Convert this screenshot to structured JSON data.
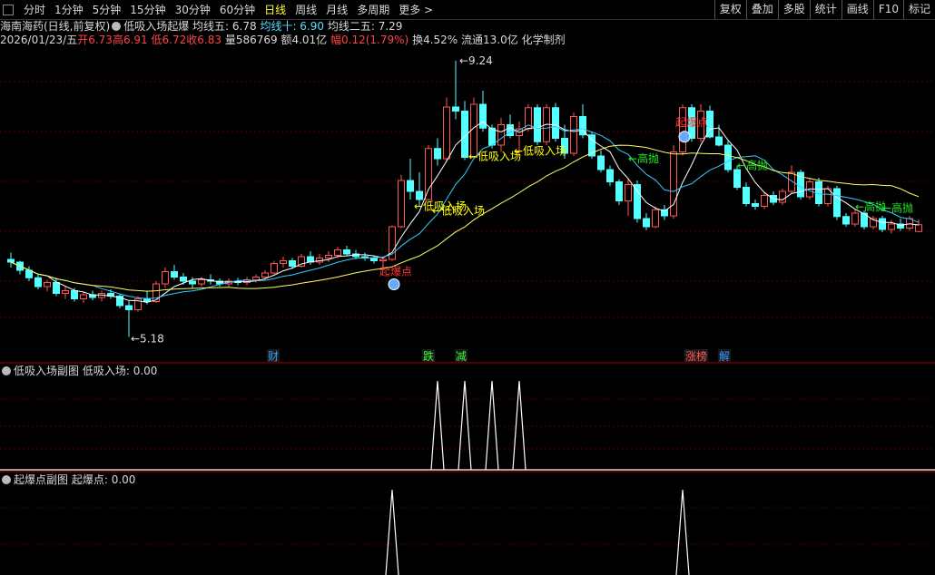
{
  "toolbar": {
    "tabs": [
      "分时",
      "1分钟",
      "5分钟",
      "15分钟",
      "30分钟",
      "60分钟",
      "日线",
      "周线",
      "月线",
      "多周期",
      "更多 >"
    ],
    "active_index": 6,
    "right_buttons": [
      "复权",
      "叠加",
      "多股",
      "统计",
      "画线",
      "F10",
      "标记"
    ]
  },
  "header": {
    "stock": "海南海药(日线,前复权)",
    "indicator": "低吸入场起爆",
    "ma5": "均线五: 6.78",
    "ma10": "均线十: 6.90",
    "ma25": "均线二五: 7.29"
  },
  "quote": {
    "date": "2026/01/23/五",
    "open": "开6.73",
    "high": "高6.91",
    "low": "低6.72",
    "close": "收6.83",
    "volume": "量586769",
    "amount": "额4.01亿",
    "change": "幅0.12(1.79%)",
    "turnover": "换4.52%",
    "float": "流通13.0亿",
    "sector": "化学制剂"
  },
  "chart_annotations": {
    "high_label": "9.24",
    "low_label": "5.18",
    "signals": [
      "低吸入场",
      "低吸入场",
      "低吸入场",
      "低吸入场"
    ],
    "burst": [
      "起爆点",
      "起爆点"
    ],
    "sell": [
      "高抛",
      "高抛",
      "高抛",
      "高抛"
    ],
    "event_tags": [
      "财",
      "跌",
      "减",
      "涨榜",
      "解"
    ]
  },
  "subchart1": {
    "label": "低吸入场副图",
    "value": "低吸入场: 0.00"
  },
  "subchart2": {
    "label": "起爆点副图",
    "value": "起爆点: 0.00"
  },
  "colors": {
    "up": "#ff5555",
    "down": "#55ffff",
    "ma5": "#ffffff",
    "ma10": "#33ccff",
    "ma25": "#ffff66",
    "signal": "#ffff00",
    "sell": "#22ee22",
    "grid": "#5a0000"
  },
  "chart_data": {
    "type": "candlestick",
    "price_range": [
      5.0,
      9.4
    ],
    "candles": [
      [
        6.32,
        6.42,
        6.2,
        6.28
      ],
      [
        6.28,
        6.3,
        6.1,
        6.16
      ],
      [
        6.16,
        6.22,
        6.0,
        6.05
      ],
      [
        6.05,
        6.1,
        5.88,
        5.92
      ],
      [
        5.92,
        6.02,
        5.85,
        5.98
      ],
      [
        5.98,
        6.05,
        5.78,
        5.82
      ],
      [
        5.82,
        5.92,
        5.74,
        5.86
      ],
      [
        5.86,
        5.9,
        5.7,
        5.74
      ],
      [
        5.74,
        5.84,
        5.68,
        5.8
      ],
      [
        5.8,
        5.86,
        5.72,
        5.76
      ],
      [
        5.76,
        5.86,
        5.7,
        5.82
      ],
      [
        5.82,
        5.88,
        5.74,
        5.78
      ],
      [
        5.78,
        5.82,
        5.6,
        5.64
      ],
      [
        5.64,
        5.72,
        5.18,
        5.58
      ],
      [
        5.58,
        5.78,
        5.55,
        5.74
      ],
      [
        5.74,
        5.86,
        5.66,
        5.7
      ],
      [
        5.7,
        6.0,
        5.68,
        5.96
      ],
      [
        5.96,
        6.2,
        5.9,
        6.14
      ],
      [
        6.14,
        6.24,
        6.02,
        6.06
      ],
      [
        6.06,
        6.12,
        5.95,
        6.0
      ],
      [
        6.0,
        6.06,
        5.9,
        5.96
      ],
      [
        5.96,
        6.06,
        5.92,
        6.02
      ],
      [
        6.02,
        6.1,
        5.95,
        6.0
      ],
      [
        6.0,
        6.04,
        5.92,
        5.96
      ],
      [
        5.96,
        6.04,
        5.92,
        6.0
      ],
      [
        6.0,
        6.05,
        5.94,
        5.98
      ],
      [
        5.98,
        6.06,
        5.94,
        6.02
      ],
      [
        6.02,
        6.1,
        5.98,
        6.06
      ],
      [
        6.06,
        6.16,
        6.02,
        6.12
      ],
      [
        6.12,
        6.3,
        6.1,
        6.26
      ],
      [
        6.26,
        6.36,
        6.2,
        6.3
      ],
      [
        6.3,
        6.34,
        6.18,
        6.22
      ],
      [
        6.22,
        6.4,
        6.2,
        6.36
      ],
      [
        6.36,
        6.44,
        6.24,
        6.28
      ],
      [
        6.28,
        6.4,
        6.24,
        6.34
      ],
      [
        6.34,
        6.44,
        6.28,
        6.38
      ],
      [
        6.38,
        6.5,
        6.34,
        6.46
      ],
      [
        6.46,
        6.52,
        6.38,
        6.4
      ],
      [
        6.4,
        6.46,
        6.32,
        6.36
      ],
      [
        6.36,
        6.42,
        6.3,
        6.34
      ],
      [
        6.34,
        6.38,
        6.26,
        6.3
      ],
      [
        6.3,
        6.36,
        6.2,
        6.32
      ],
      [
        6.32,
        6.82,
        6.3,
        6.8
      ],
      [
        6.8,
        7.56,
        6.78,
        7.48
      ],
      [
        7.48,
        7.8,
        7.2,
        7.32
      ],
      [
        7.32,
        7.6,
        7.1,
        7.2
      ],
      [
        7.2,
        8.0,
        7.18,
        7.95
      ],
      [
        7.95,
        8.1,
        7.7,
        7.8
      ],
      [
        7.8,
        8.7,
        7.75,
        8.56
      ],
      [
        8.56,
        9.24,
        8.38,
        8.5
      ],
      [
        8.5,
        8.65,
        7.78,
        7.82
      ],
      [
        7.82,
        8.7,
        7.8,
        8.6
      ],
      [
        8.6,
        8.8,
        8.2,
        8.25
      ],
      [
        8.25,
        8.3,
        7.95,
        8.0
      ],
      [
        8.0,
        8.4,
        7.9,
        8.3
      ],
      [
        8.3,
        8.45,
        8.1,
        8.14
      ],
      [
        8.14,
        8.35,
        7.86,
        8.24
      ],
      [
        8.24,
        8.6,
        8.2,
        8.55
      ],
      [
        8.55,
        8.6,
        8.0,
        8.05
      ],
      [
        8.05,
        8.6,
        8.0,
        8.55
      ],
      [
        8.55,
        8.62,
        8.05,
        8.1
      ],
      [
        8.1,
        8.3,
        7.8,
        7.88
      ],
      [
        7.88,
        8.48,
        7.84,
        8.42
      ],
      [
        8.42,
        8.6,
        8.1,
        8.15
      ],
      [
        8.15,
        8.2,
        7.8,
        7.84
      ],
      [
        7.84,
        7.92,
        7.6,
        7.64
      ],
      [
        7.64,
        7.7,
        7.4,
        7.46
      ],
      [
        7.46,
        7.5,
        7.12,
        7.18
      ],
      [
        7.18,
        7.5,
        6.96,
        7.42
      ],
      [
        7.42,
        7.48,
        6.86,
        6.92
      ],
      [
        6.92,
        7.0,
        6.75,
        6.8
      ],
      [
        6.8,
        7.1,
        6.78,
        7.05
      ],
      [
        7.05,
        7.12,
        6.9,
        6.96
      ],
      [
        6.96,
        8.0,
        6.92,
        7.9
      ],
      [
        7.9,
        8.6,
        7.85,
        8.55
      ],
      [
        8.55,
        8.6,
        8.05,
        8.1
      ],
      [
        8.1,
        8.6,
        8.05,
        8.5
      ],
      [
        8.5,
        8.58,
        8.1,
        8.12
      ],
      [
        8.12,
        8.3,
        7.98,
        8.0
      ],
      [
        8.0,
        8.06,
        7.6,
        7.64
      ],
      [
        7.64,
        7.7,
        7.34,
        7.38
      ],
      [
        7.38,
        7.45,
        7.1,
        7.14
      ],
      [
        7.14,
        7.2,
        7.05,
        7.1
      ],
      [
        7.1,
        7.3,
        7.06,
        7.26
      ],
      [
        7.26,
        7.32,
        7.12,
        7.16
      ],
      [
        7.16,
        7.36,
        7.12,
        7.32
      ],
      [
        7.32,
        7.7,
        7.28,
        7.6
      ],
      [
        7.6,
        7.64,
        7.2,
        7.24
      ],
      [
        7.24,
        7.52,
        7.2,
        7.46
      ],
      [
        7.46,
        7.52,
        7.1,
        7.14
      ],
      [
        7.14,
        7.4,
        7.1,
        7.36
      ],
      [
        7.36,
        7.4,
        6.9,
        6.95
      ],
      [
        6.95,
        7.0,
        6.8,
        6.84
      ],
      [
        6.84,
        7.06,
        6.8,
        7.0
      ],
      [
        7.0,
        7.04,
        6.76,
        6.8
      ],
      [
        6.8,
        6.96,
        6.76,
        6.92
      ],
      [
        6.92,
        6.96,
        6.72,
        6.76
      ],
      [
        6.76,
        6.9,
        6.7,
        6.84
      ],
      [
        6.84,
        6.92,
        6.74,
        6.78
      ],
      [
        6.78,
        6.96,
        6.74,
        6.92
      ],
      [
        6.73,
        6.91,
        6.72,
        6.83
      ]
    ],
    "subchart1_peaks": [
      47,
      50,
      53,
      56
    ],
    "subchart2_peaks": [
      42,
      74
    ]
  }
}
